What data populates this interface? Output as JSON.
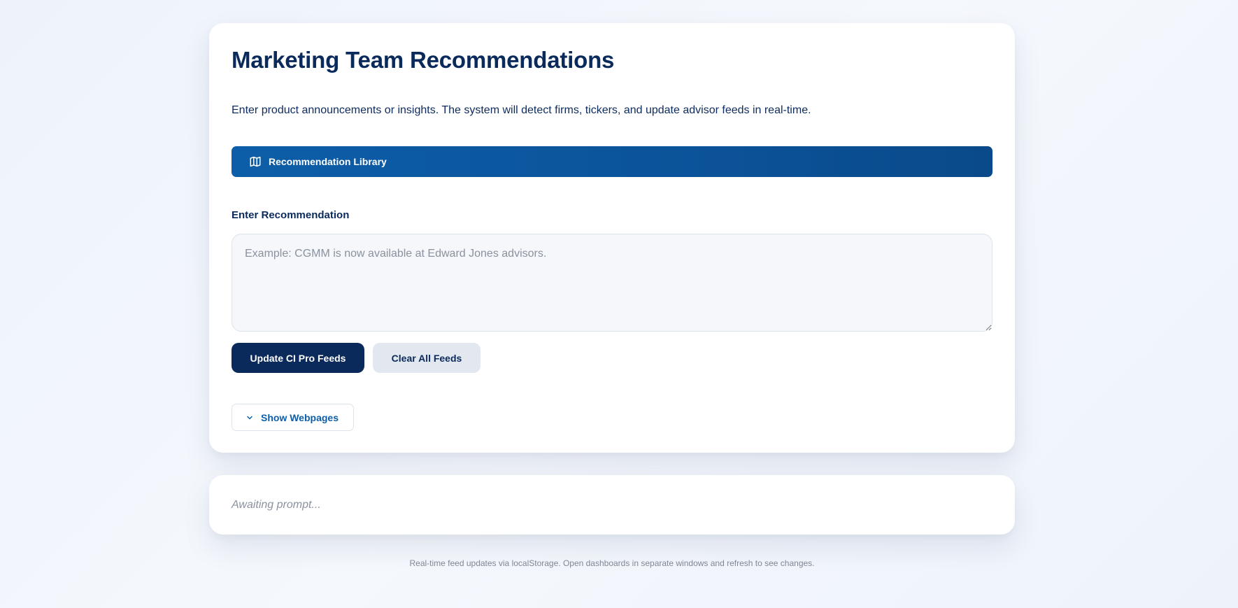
{
  "header": {
    "title": "Marketing Team Recommendations",
    "subtitle": "Enter product announcements or insights. The system will detect firms, tickers, and update advisor feeds in real-time."
  },
  "library": {
    "label": "Recommendation Library",
    "icon": "book-open-icon"
  },
  "recommendation": {
    "label": "Enter Recommendation",
    "placeholder": "Example: CGMM is now available at Edward Jones advisors.",
    "value": ""
  },
  "actions": {
    "update_label": "Update CI Pro Feeds",
    "clear_label": "Clear All Feeds"
  },
  "webpages": {
    "label": "Show Webpages",
    "icon": "chevron-down-icon"
  },
  "status": {
    "text": "Awaiting prompt..."
  },
  "footer": {
    "note": "Real-time feed updates via localStorage. Open dashboards in separate windows and refresh to see changes."
  },
  "colors": {
    "primary": "#0b2a5c",
    "accent": "#0d5ea8",
    "secondary_button": "#e2e7f0",
    "background": "#eef3fb"
  }
}
